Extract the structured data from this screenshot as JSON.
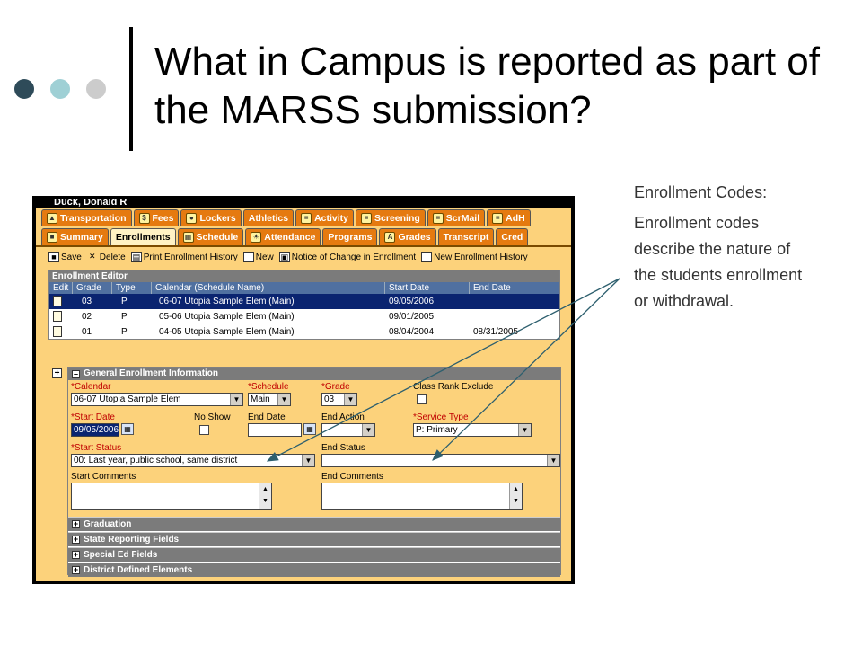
{
  "slide": {
    "title": "What in Campus is reported as part of the MARSS submission?",
    "note_heading": "Enrollment Codes:",
    "note_body": "Enrollment codes describe the nature of the students enrollment or withdrawal."
  },
  "student_name": "Duck, Donald R",
  "tabs_row1": [
    {
      "label": "Transportation",
      "icon": "bus-icon"
    },
    {
      "label": "Fees",
      "icon": "dollar-icon"
    },
    {
      "label": "Lockers",
      "icon": "lock-icon"
    },
    {
      "label": "Athletics",
      "icon": ""
    },
    {
      "label": "Activity",
      "icon": "card-icon"
    },
    {
      "label": "Screening",
      "icon": "card-icon"
    },
    {
      "label": "ScrMail",
      "icon": "card-icon"
    },
    {
      "label": "AdH",
      "icon": "card-icon"
    }
  ],
  "tabs_row2": [
    {
      "label": "Summary",
      "icon": "summary-icon",
      "active": false
    },
    {
      "label": "Enrollments",
      "icon": "",
      "active": true
    },
    {
      "label": "Schedule",
      "icon": "schedule-icon",
      "active": false
    },
    {
      "label": "Attendance",
      "icon": "sun-icon",
      "active": false
    },
    {
      "label": "Programs",
      "icon": "",
      "active": false
    },
    {
      "label": "Grades",
      "icon": "grades-icon",
      "active": false
    },
    {
      "label": "Transcript",
      "icon": "",
      "active": false
    },
    {
      "label": "Cred",
      "icon": "",
      "active": false
    }
  ],
  "toolbar": {
    "save": "Save",
    "delete": "Delete",
    "print_history": "Print Enrollment History",
    "new": "New",
    "notice": "Notice of Change in Enrollment",
    "new_history": "New Enrollment History"
  },
  "editor": {
    "title": "Enrollment Editor",
    "columns": [
      "Edit",
      "Grade",
      "Type",
      "Calendar (Schedule Name)",
      "Start Date",
      "End Date"
    ],
    "rows": [
      {
        "grade": "03",
        "type": "P",
        "calendar": "06-07 Utopia Sample Elem (Main)",
        "start": "09/05/2006",
        "end": ""
      },
      {
        "grade": "02",
        "type": "P",
        "calendar": "05-06 Utopia Sample Elem (Main)",
        "start": "09/01/2005",
        "end": ""
      },
      {
        "grade": "01",
        "type": "P",
        "calendar": "04-05 Utopia Sample Elem (Main)",
        "start": "08/04/2004",
        "end": "08/31/2005"
      }
    ]
  },
  "general": {
    "title": "General Enrollment Information",
    "calendar_label": "*Calendar",
    "calendar_value": "06-07 Utopia Sample Elem",
    "schedule_label": "*Schedule",
    "schedule_value": "Main",
    "grade_label": "*Grade",
    "grade_value": "03",
    "class_rank_label": "Class Rank Exclude",
    "start_date_label": "*Start Date",
    "start_date_value": "09/05/2006",
    "no_show_label": "No Show",
    "end_date_label": "End Date",
    "end_action_label": "End Action",
    "service_type_label": "*Service Type",
    "service_type_value": "P: Primary",
    "start_status_label": "*Start Status",
    "start_status_value": "00: Last year, public school, same district",
    "end_status_label": "End Status",
    "start_comments_label": "Start Comments",
    "end_comments_label": "End Comments"
  },
  "sections": [
    "Graduation",
    "State Reporting Fields",
    "Special Ed Fields",
    "District Defined Elements"
  ]
}
